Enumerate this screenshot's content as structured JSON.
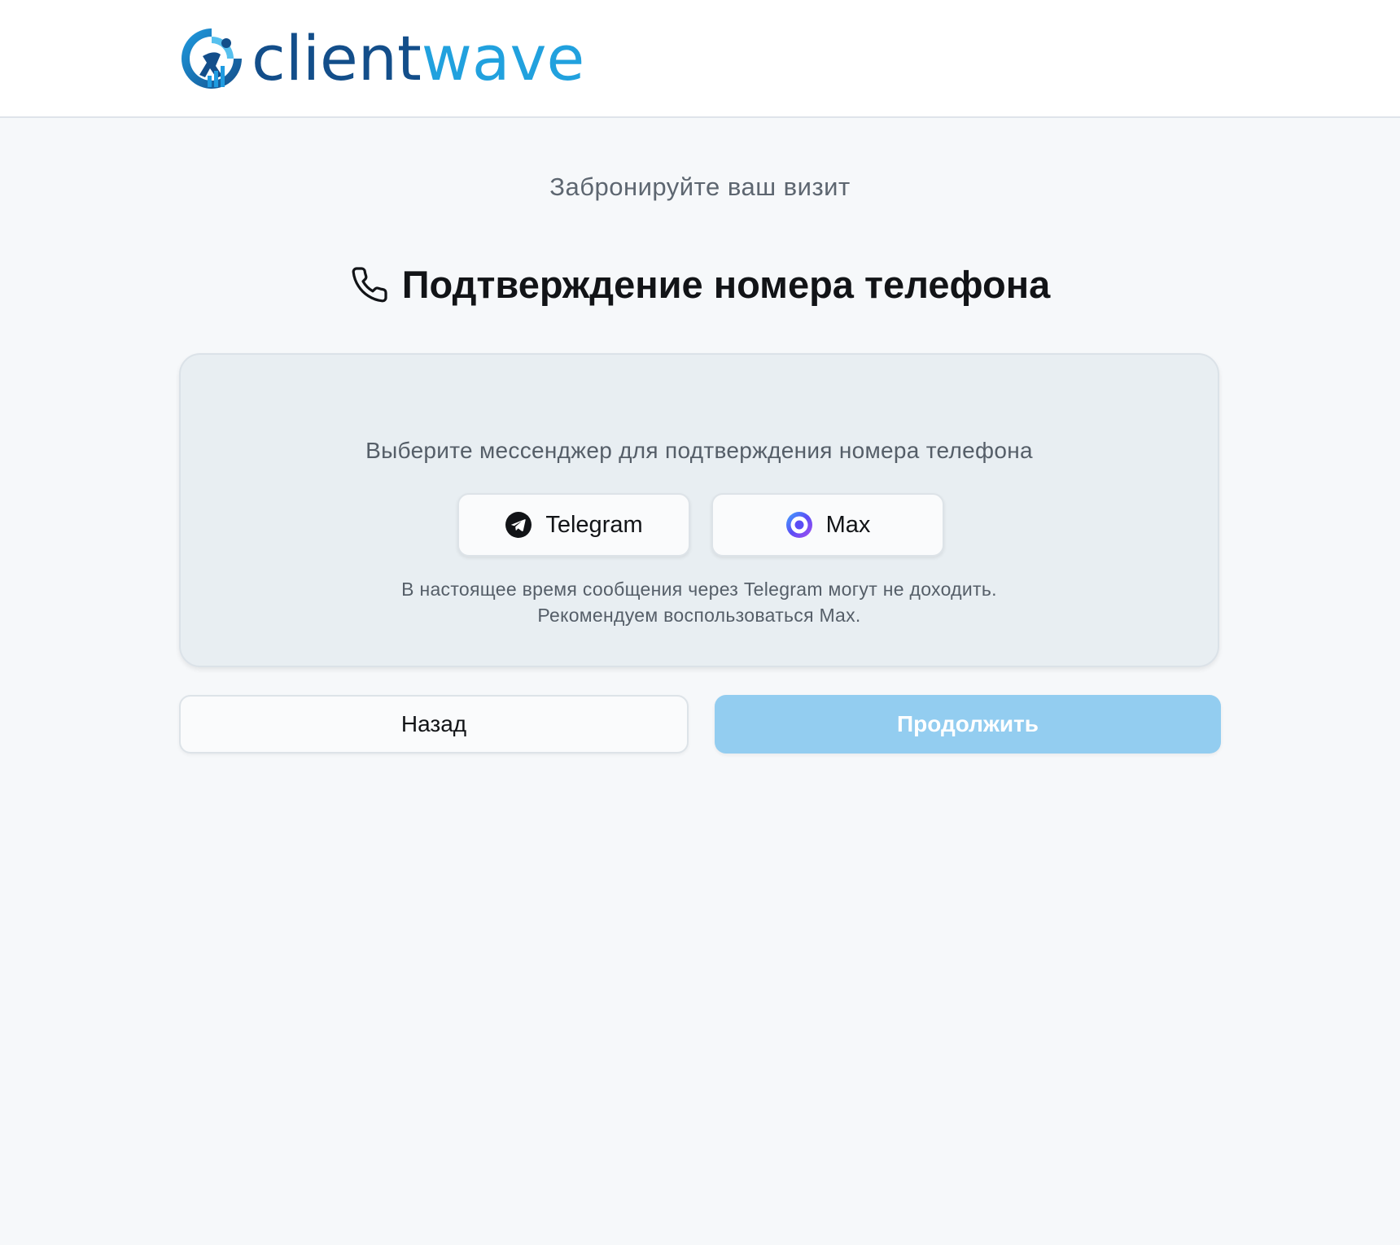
{
  "brand": {
    "name_part1": "client",
    "name_part2": "wave",
    "logo_icon": "logo-mark-icon",
    "color_dark": "#134e8a",
    "color_light": "#21a1de"
  },
  "page": {
    "subtitle": "Забронируйте ваш визит",
    "title": "Подтверждение номера телефона",
    "title_icon": "phone-icon"
  },
  "card": {
    "prompt": "Выберите мессенджер для подтверждения номера телефона",
    "messengers": [
      {
        "label": "Telegram",
        "icon": "telegram-icon"
      },
      {
        "label": "Max",
        "icon": "max-icon"
      }
    ],
    "note_line1": "В настоящее время сообщения через Telegram могут не доходить.",
    "note_line2": "Рекомендуем воспользоваться Max."
  },
  "actions": {
    "back_label": "Назад",
    "continue_label": "Продолжить",
    "continue_color": "#93cdf0"
  }
}
